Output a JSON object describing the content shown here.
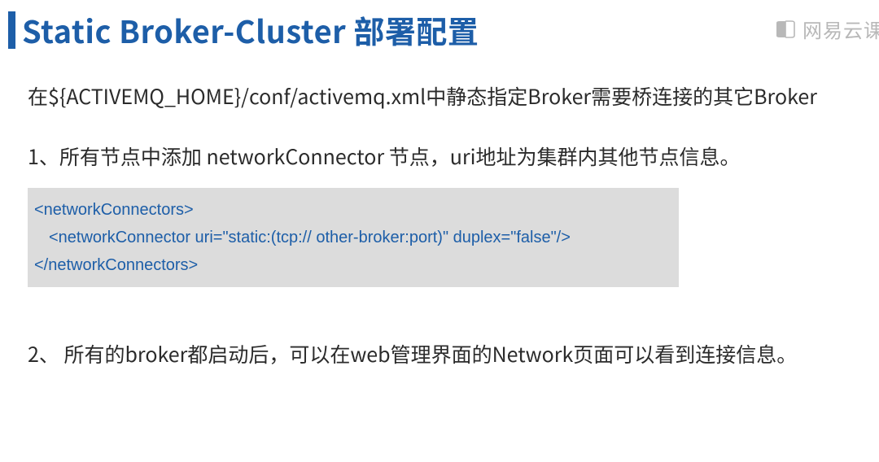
{
  "title": "Static Broker-Cluster 部署配置",
  "watermark": {
    "text": "网易云课",
    "icon_name": "book-icon"
  },
  "intro": "在${ACTIVEMQ_HOME}/conf/activemq.xml中静态指定Broker需要桥连接的其它Broker",
  "step1": "1、所有节点中添加 networkConnector 节点，uri地址为集群内其他节点信息。",
  "code": {
    "line1": "<networkConnectors>",
    "line2": "<networkConnector  uri=\"static:(tcp:// other-broker:port)\" duplex=\"false\"/>",
    "line3": "</networkConnectors>"
  },
  "step2": "2、 所有的broker都启动后，可以在web管理界面的Network页面可以看到连接信息。"
}
